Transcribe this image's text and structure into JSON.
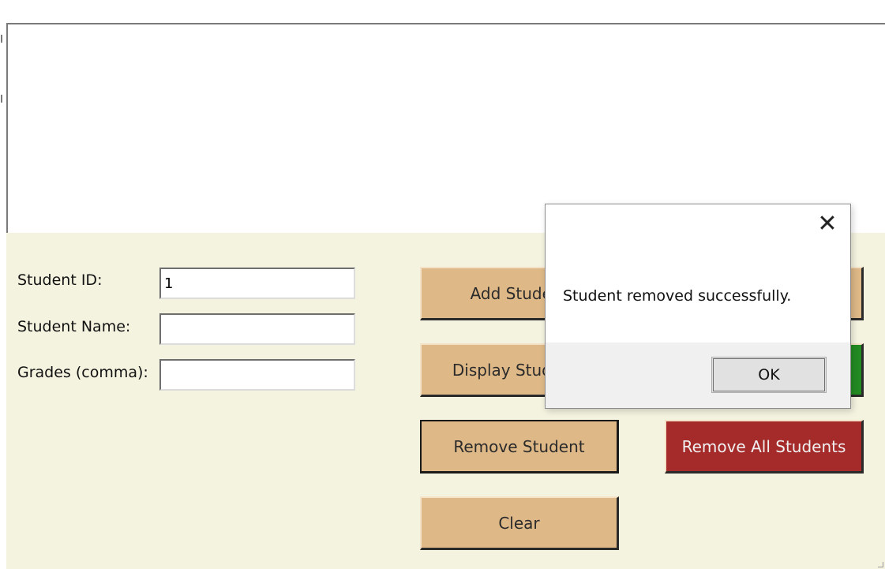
{
  "form": {
    "student_id_label": "Student ID:",
    "student_id_value": "1",
    "student_name_label": "Student Name:",
    "student_name_value": "",
    "grades_label": "Grades (comma):",
    "grades_value": ""
  },
  "buttons": {
    "add_student": "Add Student",
    "display_students": "Display Students",
    "remove_student": "Remove Student",
    "clear": "Clear",
    "remove_all_students": "Remove All Students"
  },
  "dialog": {
    "message": "Student removed successfully.",
    "ok_label": "OK",
    "close_glyph": "✕"
  },
  "colors": {
    "panel_background": "#f4f3e0",
    "button_tan": "#deb887",
    "button_red": "#a52a2a",
    "button_green": "#228b22"
  },
  "icons": {
    "dialog_close": "close-icon"
  }
}
